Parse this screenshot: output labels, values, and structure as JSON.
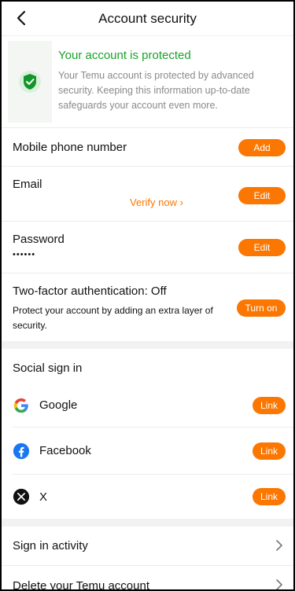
{
  "header": {
    "title": "Account security"
  },
  "protection": {
    "title": "Your account is protected",
    "description": "Your Temu account is protected by advanced security. Keeping this information up-to-date safeguards your account even more."
  },
  "phone": {
    "label": "Mobile phone number",
    "button": "Add"
  },
  "email": {
    "label": "Email",
    "verify": "Verify now ›",
    "button": "Edit"
  },
  "password": {
    "label": "Password",
    "value": "••••••",
    "button": "Edit"
  },
  "two_factor": {
    "label": "Two-factor authentication: Off",
    "description": "Protect your account by adding an extra layer of security.",
    "button": "Turn on"
  },
  "social": {
    "title": "Social sign in",
    "items": [
      {
        "name": "Google",
        "button": "Link"
      },
      {
        "name": "Facebook",
        "button": "Link"
      },
      {
        "name": "X",
        "button": "Link"
      }
    ]
  },
  "links": {
    "sign_in_activity": "Sign in activity",
    "delete_account": "Delete your Temu account"
  },
  "colors": {
    "accent": "#fb7701",
    "success": "#18a32b"
  }
}
